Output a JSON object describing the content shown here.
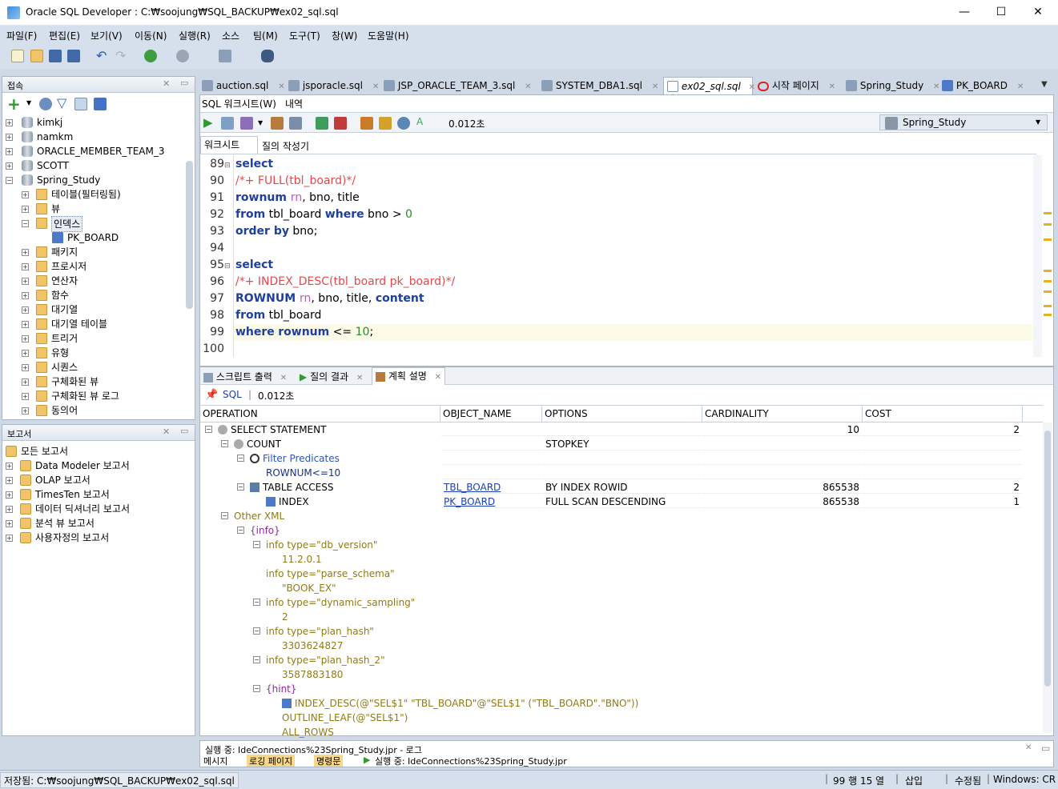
{
  "window": {
    "title": "Oracle SQL Developer : C:₩soojung₩SQL_BACKUP₩ex02_sql.sql",
    "minimize": "—",
    "maximize": "☐",
    "close": "✕"
  },
  "menu": [
    "파일(F)",
    "편집(E)",
    "보기(V)",
    "이동(N)",
    "실행(R)",
    "소스",
    "팀(M)",
    "도구(T)",
    "창(W)",
    "도움말(H)"
  ],
  "connections_panel": {
    "title": "접속",
    "items": [
      {
        "label": "kimkj"
      },
      {
        "label": "namkm"
      },
      {
        "label": "ORACLE_MEMBER_TEAM_3"
      },
      {
        "label": "SCOTT"
      },
      {
        "label": "Spring_Study"
      }
    ],
    "children": [
      "테이블(필터링됨)",
      "뷰",
      "인덱스",
      "PK_BOARD",
      "패키지",
      "프로시저",
      "연산자",
      "함수",
      "대기열",
      "대기열 테이블",
      "트리거",
      "유형",
      "시퀀스",
      "구체화된 뷰",
      "구체화된 뷰 로그",
      "동의어"
    ]
  },
  "reports_panel": {
    "title": "보고서",
    "items": [
      "모든 보고서",
      "Data Modeler 보고서",
      "OLAP 보고서",
      "TimesTen 보고서",
      "데이터 딕셔너리 보고서",
      "분석 뷰 보고서",
      "사용자정의 보고서"
    ]
  },
  "editor_tabs": [
    "auction.sql",
    "jsporacle.sql",
    "JSP_ORACLE_TEAM_3.sql",
    "SYSTEM_DBA1.sql",
    "ex02_sql.sql",
    "시작 페이지",
    "Spring_Study",
    "PK_BOARD"
  ],
  "worksheet": {
    "subtabs": [
      "SQL 워크시트(W)",
      "내역"
    ],
    "elapsed": "0.012초",
    "connection": "Spring_Study",
    "mode_tabs": [
      "워크시트",
      "질의 작성기"
    ]
  },
  "code_lines": [
    {
      "n": "89",
      "parts": [
        [
          "kw",
          "select"
        ]
      ]
    },
    {
      "n": "90",
      "parts": [
        [
          "hint",
          "/*+ FULL(tbl_board)*/"
        ]
      ]
    },
    {
      "n": "91",
      "parts": [
        [
          "kw",
          "rownum "
        ],
        [
          "pink",
          "rn"
        ],
        [
          "plain",
          ", bno, title"
        ]
      ]
    },
    {
      "n": "92",
      "parts": [
        [
          "kw",
          "from"
        ],
        [
          "plain",
          " tbl_board "
        ],
        [
          "kw",
          "where"
        ],
        [
          "plain",
          " bno > "
        ],
        [
          "num",
          "0"
        ]
      ]
    },
    {
      "n": "93",
      "parts": [
        [
          "kw",
          "order by"
        ],
        [
          "plain",
          " bno;"
        ]
      ]
    },
    {
      "n": "94",
      "parts": []
    },
    {
      "n": "95",
      "parts": [
        [
          "kw",
          "select"
        ]
      ]
    },
    {
      "n": "96",
      "parts": [
        [
          "hint",
          "/*+ INDEX_DESC(tbl_board pk_board)*/"
        ]
      ]
    },
    {
      "n": "97",
      "parts": [
        [
          "kw",
          "ROWNUM "
        ],
        [
          "pink",
          "rn"
        ],
        [
          "plain",
          ", bno, title, "
        ],
        [
          "kw",
          "content"
        ]
      ]
    },
    {
      "n": "98",
      "parts": [
        [
          "kw",
          "from"
        ],
        [
          "plain",
          " tbl_board"
        ]
      ]
    },
    {
      "n": "99",
      "parts": [
        [
          "kw",
          "where"
        ],
        [
          "plain",
          " "
        ],
        [
          "kw",
          "rownum"
        ],
        [
          "plain",
          " <= "
        ],
        [
          "num",
          "10"
        ],
        [
          "plain",
          ";"
        ]
      ]
    },
    {
      "n": "100",
      "parts": []
    }
  ],
  "result_tabs": [
    "스크립트 출력",
    "질의 결과",
    "계획 설명"
  ],
  "plan": {
    "sql_label": "SQL",
    "elapsed": "0.012초",
    "columns": [
      "OPERATION",
      "OBJECT_NAME",
      "OPTIONS",
      "CARDINALITY",
      "COST"
    ],
    "rows": [
      {
        "op": "SELECT STATEMENT",
        "obj": "",
        "opt": "",
        "card": "10",
        "cost": "2"
      },
      {
        "op": "COUNT",
        "obj": "",
        "opt": "STOPKEY",
        "card": "",
        "cost": ""
      },
      {
        "op": "Filter Predicates",
        "obj": "",
        "opt": "",
        "card": "",
        "cost": ""
      },
      {
        "op": "ROWNUM<=10",
        "obj": "",
        "opt": "",
        "card": "",
        "cost": ""
      },
      {
        "op": "TABLE ACCESS",
        "obj": "TBL_BOARD",
        "opt": "BY INDEX ROWID",
        "card": "865538",
        "cost": "2"
      },
      {
        "op": "INDEX",
        "obj": "PK_BOARD",
        "opt": "FULL SCAN DESCENDING",
        "card": "865538",
        "cost": "1"
      },
      {
        "op": "Other XML",
        "obj": "",
        "opt": "",
        "card": "",
        "cost": ""
      },
      {
        "op": "{info}",
        "obj": "",
        "opt": "",
        "card": "",
        "cost": ""
      },
      {
        "op": "info type=\"db_version\"",
        "obj": "",
        "opt": "",
        "card": "",
        "cost": ""
      },
      {
        "op": "11.2.0.1",
        "obj": "",
        "opt": "",
        "card": "",
        "cost": ""
      },
      {
        "op": "info type=\"parse_schema\"",
        "obj": "",
        "opt": "",
        "card": "",
        "cost": ""
      },
      {
        "op": "\"BOOK_EX\"",
        "obj": "",
        "opt": "",
        "card": "",
        "cost": ""
      },
      {
        "op": "info type=\"dynamic_sampling\"",
        "obj": "",
        "opt": "",
        "card": "",
        "cost": ""
      },
      {
        "op": "2",
        "obj": "",
        "opt": "",
        "card": "",
        "cost": ""
      },
      {
        "op": "info type=\"plan_hash\"",
        "obj": "",
        "opt": "",
        "card": "",
        "cost": ""
      },
      {
        "op": "3303624827",
        "obj": "",
        "opt": "",
        "card": "",
        "cost": ""
      },
      {
        "op": "info type=\"plan_hash_2\"",
        "obj": "",
        "opt": "",
        "card": "",
        "cost": ""
      },
      {
        "op": "3587883180",
        "obj": "",
        "opt": "",
        "card": "",
        "cost": ""
      },
      {
        "op": "{hint}",
        "obj": "",
        "opt": "",
        "card": "",
        "cost": ""
      },
      {
        "op": "INDEX_DESC(@\"SEL$1\" \"TBL_BOARD\"@\"SEL$1\" (\"TBL_BOARD\".\"BNO\"))",
        "obj": "",
        "opt": "",
        "card": "",
        "cost": ""
      },
      {
        "op": "OUTLINE_LEAF(@\"SEL$1\")",
        "obj": "",
        "opt": "",
        "card": "",
        "cost": ""
      },
      {
        "op": "ALL_ROWS",
        "obj": "",
        "opt": "",
        "card": "",
        "cost": ""
      }
    ]
  },
  "log_panel": {
    "title": "실행 중: IdeConnections%23Spring_Study.jpr - 로그",
    "tabs": [
      "메시지",
      "로깅 페이지",
      "명령문",
      "실행 중: IdeConnections%23Spring_Study.jpr"
    ]
  },
  "status": {
    "saved": "저장됨: C:₩soojung₩SQL_BACKUP₩ex02_sql.sql",
    "position": "99 행 15 열",
    "mode": "삽입",
    "modified": "수정됨",
    "eol": "Windows: CR"
  },
  "colors": {
    "accent": "#1e3f9e",
    "hint": "#e5484d",
    "toolbar_bg": "#d6e0ec"
  }
}
